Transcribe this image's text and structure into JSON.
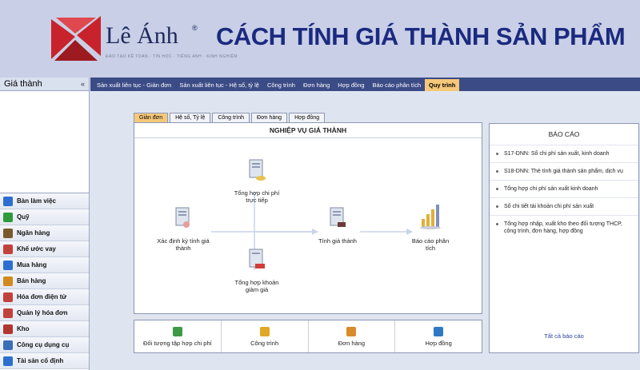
{
  "banner": {
    "brand": "Lê Ánh",
    "brand_reg": "®",
    "tagline": "ĐÀO TẠO KẾ TOÁN · TIN HỌC · TIẾNG ANH · KINH NGHIỆM",
    "title": "CÁCH TÍNH GIÁ THÀNH SẢN PHẨM",
    "colors": {
      "logo_red": "#c8232c",
      "title_blue": "#1b2a80"
    }
  },
  "left_panel": {
    "title": "Giá thành",
    "collapse": "«",
    "items": [
      {
        "label": "Bàn làm việc",
        "icon": "desk-chart-icon",
        "color": "#2d6fd1"
      },
      {
        "label": "Quỹ",
        "icon": "cash-icon",
        "color": "#2f9a3c"
      },
      {
        "label": "Ngân hàng",
        "icon": "bank-icon",
        "color": "#7a5a2c"
      },
      {
        "label": "Khế ước vay",
        "icon": "contract-icon",
        "color": "#c2413a"
      },
      {
        "label": "Mua hàng",
        "icon": "cart-icon",
        "color": "#2d6fd1"
      },
      {
        "label": "Bán hàng",
        "icon": "sales-icon",
        "color": "#d28a1f"
      },
      {
        "label": "Hóa đơn điện tử",
        "icon": "invoice-icon",
        "color": "#c2413a"
      },
      {
        "label": "Quản lý hóa đơn",
        "icon": "invoice-manage-icon",
        "color": "#c2413a"
      },
      {
        "label": "Kho",
        "icon": "warehouse-icon",
        "color": "#b2362f"
      },
      {
        "label": "Công cụ dụng cụ",
        "icon": "tools-icon",
        "color": "#3a6db7"
      },
      {
        "label": "Tài sản cố định",
        "icon": "asset-icon",
        "color": "#2d6fd1"
      }
    ]
  },
  "top_tabs": [
    {
      "label": "Sản xuất liên tục - Giản đơn",
      "active": false
    },
    {
      "label": "Sản xuất liên tục - Hệ số, tỷ lệ",
      "active": false
    },
    {
      "label": "Công trình",
      "active": false
    },
    {
      "label": "Đơn hàng",
      "active": false
    },
    {
      "label": "Hợp đồng",
      "active": false
    },
    {
      "label": "Báo cáo phân tích",
      "active": false
    },
    {
      "label": "Quy trình",
      "active": true
    }
  ],
  "sub_tabs": [
    {
      "label": "Giản đơn",
      "active": true
    },
    {
      "label": "Hệ số, Tỷ lệ",
      "active": false
    },
    {
      "label": "Công trình",
      "active": false
    },
    {
      "label": "Đơn hàng",
      "active": false
    },
    {
      "label": "Hợp đồng",
      "active": false
    }
  ],
  "process": {
    "title": "NGHIỆP VỤ GIÁ THÀNH",
    "nodes": {
      "direct_cost": "Tổng hợp chi phí trực tiếp",
      "define_period": "Xác định kỳ tính giá thành",
      "reductions": "Tổng hợp khoản giảm giá",
      "calc_cost": "Tính giá thành",
      "analysis_report": "Báo cáo phân tích"
    }
  },
  "shortcuts": [
    {
      "label": "Đối tượng tập hợp chi phí",
      "icon": "cost-object-icon"
    },
    {
      "label": "Công trình",
      "icon": "construction-icon"
    },
    {
      "label": "Đơn hàng",
      "icon": "order-icon"
    },
    {
      "label": "Hợp đồng",
      "icon": "contract-doc-icon"
    }
  ],
  "reports": {
    "title": "BÁO CÁO",
    "items": [
      "S17-DNN: Sổ chi phí sản xuất, kinh doanh",
      "S18-DNN: Thẻ tính giá thành sản phẩm, dịch vụ",
      "Tổng hợp chi phí sản xuất kinh doanh",
      "Sổ chi tiết tài khoản chi phí sản xuất",
      "Tổng hợp nhập, xuất kho theo đối tượng THCP, công trình, đơn hàng, hợp đồng"
    ],
    "all_link": "Tất cả báo cáo"
  }
}
